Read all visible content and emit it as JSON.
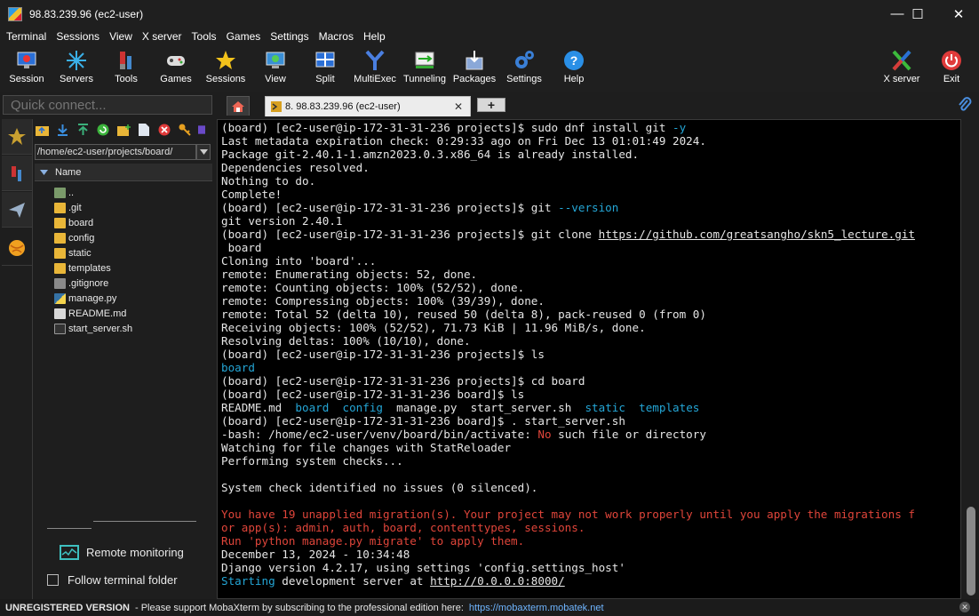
{
  "window": {
    "title": "98.83.239.96 (ec2-user)",
    "minimize": "—",
    "maximize": "☐",
    "close": "✕"
  },
  "menu": [
    "Terminal",
    "Sessions",
    "View",
    "X server",
    "Tools",
    "Games",
    "Settings",
    "Macros",
    "Help"
  ],
  "toolbar": {
    "session": "Session",
    "servers": "Servers",
    "tools": "Tools",
    "games": "Games",
    "sessions": "Sessions",
    "view": "View",
    "split": "Split",
    "multiexec": "MultiExec",
    "tunneling": "Tunneling",
    "packages": "Packages",
    "settings": "Settings",
    "help": "Help",
    "xserver": "X server",
    "exit": "Exit"
  },
  "quick_connect": {
    "placeholder": "Quick connect..."
  },
  "tabs": {
    "session_tab": "8. 98.83.239.96 (ec2-user)",
    "close": "✕",
    "new_tab": "+"
  },
  "sftp": {
    "path": "/home/ec2-user/projects/board/",
    "column_name": "Name",
    "files": [
      {
        "name": "..",
        "type": "up"
      },
      {
        "name": ".git",
        "type": "folder"
      },
      {
        "name": "board",
        "type": "folder"
      },
      {
        "name": "config",
        "type": "folder"
      },
      {
        "name": "static",
        "type": "folder"
      },
      {
        "name": "templates",
        "type": "folder"
      },
      {
        "name": ".gitignore",
        "type": "file"
      },
      {
        "name": "manage.py",
        "type": "py"
      },
      {
        "name": "README.md",
        "type": "md"
      },
      {
        "name": "start_server.sh",
        "type": "sh"
      }
    ],
    "remote_monitoring": "Remote monitoring",
    "follow_terminal_folder": "Follow terminal folder"
  },
  "terminal": {
    "lines": [
      {
        "segs": [
          {
            "t": "(board) [ec2-user@ip-172-31-31-236 projects]$ sudo dnf install git "
          },
          {
            "t": "-y",
            "c": "c-cyan"
          }
        ]
      },
      {
        "segs": [
          {
            "t": "Last metadata expiration check: 0:29:33 ago on Fri Dec 13 01:01:49 2024."
          }
        ]
      },
      {
        "segs": [
          {
            "t": "Package git-2.40.1-1.amzn2023.0.3.x86_64 is already installed."
          }
        ]
      },
      {
        "segs": [
          {
            "t": "Dependencies resolved."
          }
        ]
      },
      {
        "segs": [
          {
            "t": "Nothing to do."
          }
        ]
      },
      {
        "segs": [
          {
            "t": "Complete!"
          }
        ]
      },
      {
        "segs": [
          {
            "t": "(board) [ec2-user@ip-172-31-31-236 projects]$ git "
          },
          {
            "t": "--version",
            "c": "c-cyan"
          }
        ]
      },
      {
        "segs": [
          {
            "t": "git version 2.40.1"
          }
        ]
      },
      {
        "segs": [
          {
            "t": "(board) [ec2-user@ip-172-31-31-236 projects]$ git clone "
          },
          {
            "t": "https://github.com/greatsangho/skn5_lecture.git",
            "c": "ul"
          }
        ]
      },
      {
        "segs": [
          {
            "t": " board"
          }
        ]
      },
      {
        "segs": [
          {
            "t": "Cloning into 'board'..."
          }
        ]
      },
      {
        "segs": [
          {
            "t": "remote: Enumerating objects: 52, done."
          }
        ]
      },
      {
        "segs": [
          {
            "t": "remote: Counting objects: 100% (52/52), done."
          }
        ]
      },
      {
        "segs": [
          {
            "t": "remote: Compressing objects: 100% (39/39), done."
          }
        ]
      },
      {
        "segs": [
          {
            "t": "remote: Total 52 (delta 10), reused 50 (delta 8), pack-reused 0 (from 0)"
          }
        ]
      },
      {
        "segs": [
          {
            "t": "Receiving objects: 100% (52/52), 71.73 KiB | 11.96 MiB/s, done."
          }
        ]
      },
      {
        "segs": [
          {
            "t": "Resolving deltas: 100% (10/10), done."
          }
        ]
      },
      {
        "segs": [
          {
            "t": "(board) [ec2-user@ip-172-31-31-236 projects]$ ls"
          }
        ]
      },
      {
        "segs": [
          {
            "t": "board",
            "c": "c-cyan"
          }
        ]
      },
      {
        "segs": [
          {
            "t": "(board) [ec2-user@ip-172-31-31-236 projects]$ cd board"
          }
        ]
      },
      {
        "segs": [
          {
            "t": "(board) [ec2-user@ip-172-31-31-236 board]$ ls"
          }
        ]
      },
      {
        "segs": [
          {
            "t": "README.md  "
          },
          {
            "t": "board",
            "c": "c-cyan"
          },
          {
            "t": "  "
          },
          {
            "t": "config",
            "c": "c-cyan"
          },
          {
            "t": "  manage.py  start_server.sh  "
          },
          {
            "t": "static",
            "c": "c-cyan"
          },
          {
            "t": "  "
          },
          {
            "t": "templates",
            "c": "c-cyan"
          }
        ]
      },
      {
        "segs": [
          {
            "t": "(board) [ec2-user@ip-172-31-31-236 board]$ . start_server.sh"
          }
        ]
      },
      {
        "segs": [
          {
            "t": "-bash: /home/ec2-user/venv/board/bin/activate: "
          },
          {
            "t": "No",
            "c": "c-red"
          },
          {
            "t": " such file or directory"
          }
        ]
      },
      {
        "segs": [
          {
            "t": "Watching for file changes with StatReloader"
          }
        ]
      },
      {
        "segs": [
          {
            "t": "Performing system checks..."
          }
        ]
      },
      {
        "segs": [
          {
            "t": ""
          }
        ]
      },
      {
        "segs": [
          {
            "t": "System check identified no issues (0 silenced)."
          }
        ]
      },
      {
        "segs": [
          {
            "t": ""
          }
        ]
      },
      {
        "segs": [
          {
            "t": "You have 19 unapplied migration(s). Your project may not work properly until you apply the migrations f",
            "c": "c-red"
          }
        ]
      },
      {
        "segs": [
          {
            "t": "or app(s): admin, auth, board, contenttypes, sessions.",
            "c": "c-red"
          }
        ]
      },
      {
        "segs": [
          {
            "t": "Run 'python manage.py migrate' to apply them.",
            "c": "c-red"
          }
        ]
      },
      {
        "segs": [
          {
            "t": "December 13, 2024 - 10:34:48"
          }
        ]
      },
      {
        "segs": [
          {
            "t": "Django version 4.2.17, using settings 'config.settings_host'"
          }
        ]
      },
      {
        "segs": [
          {
            "t": "Starting",
            "c": "c-cyan"
          },
          {
            "t": " development server at "
          },
          {
            "t": "http://0.0.0.0:8000/",
            "c": "ul"
          }
        ]
      }
    ]
  },
  "status": {
    "registration": "UNREGISTERED VERSION",
    "message": "-  Please support MobaXterm by subscribing to the professional edition here:",
    "link": "https://mobaxterm.mobatek.net",
    "close": "✕"
  }
}
